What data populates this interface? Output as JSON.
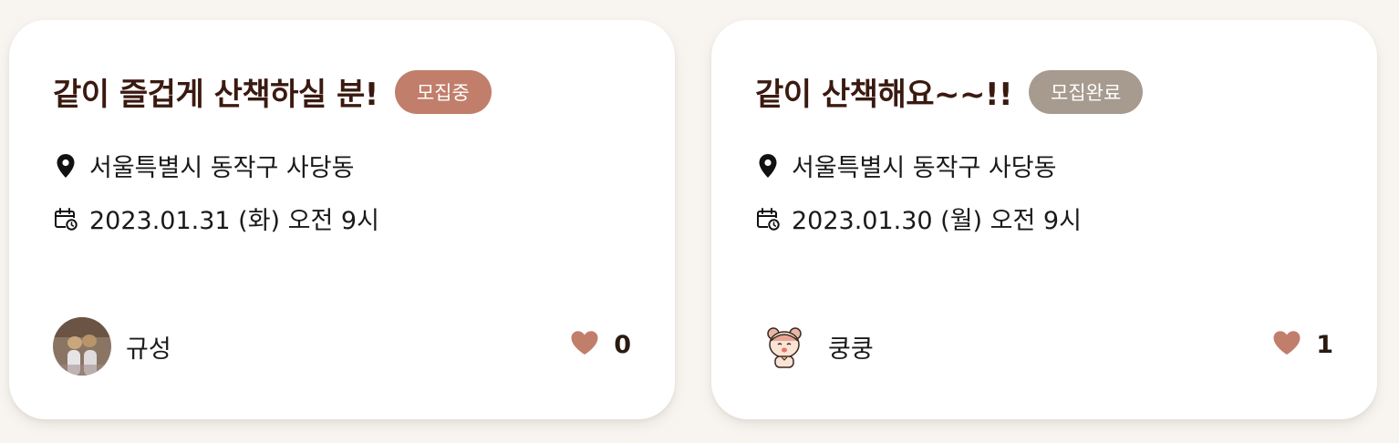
{
  "cards": [
    {
      "title": "같이 즐겁게 산책하실 분!",
      "status": "모집중",
      "status_color": "#c17e6a",
      "location": "서울특별시 동작구 사당동",
      "datetime": "2023.01.31 (화) 오전 9시",
      "author": "규성",
      "likes": "0"
    },
    {
      "title": "같이 산책해요~~!!",
      "status": "모집완료",
      "status_color": "#a79a8f",
      "location": "서울특별시 동작구 사당동",
      "datetime": "2023.01.30 (월) 오전 9시",
      "author": "쿵쿵",
      "likes": "1"
    }
  ],
  "colors": {
    "title": "#3a1a10",
    "heart": "#c17e6a",
    "background": "#f8f5f1"
  },
  "icons": {
    "location": "location-pin-icon",
    "date": "calendar-clock-icon",
    "like": "heart-icon"
  }
}
